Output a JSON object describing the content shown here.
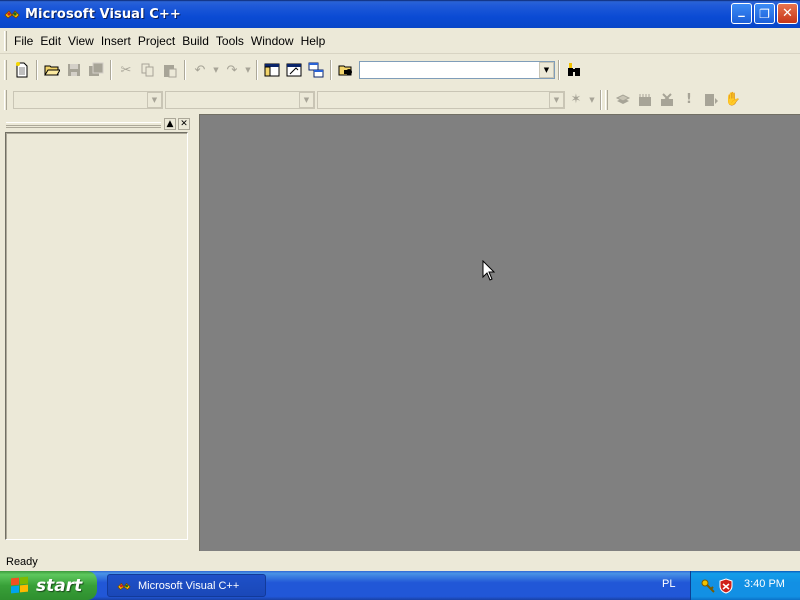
{
  "window": {
    "title": "Microsoft Visual C++"
  },
  "title_buttons": {
    "minimize": "_",
    "maximize": "❐",
    "close": "✕"
  },
  "menu": {
    "items": [
      "File",
      "Edit",
      "View",
      "Insert",
      "Project",
      "Build",
      "Tools",
      "Window",
      "Help"
    ]
  },
  "toolbar": {
    "find_combo_value": ""
  },
  "wizardbar": {
    "class_combo_value": "",
    "filter_combo_value": "",
    "member_combo_value": ""
  },
  "statusbar": {
    "text": "Ready"
  },
  "taskbar": {
    "start_label": "start",
    "task_label": "Microsoft Visual C++",
    "language": "PL",
    "clock": "3:40 PM"
  },
  "colors": {
    "titlebar": "#0b4bd4",
    "workspace": "#808080",
    "chrome": "#ece9d8",
    "start": "#38a038",
    "taskbar": "#2157d7"
  }
}
